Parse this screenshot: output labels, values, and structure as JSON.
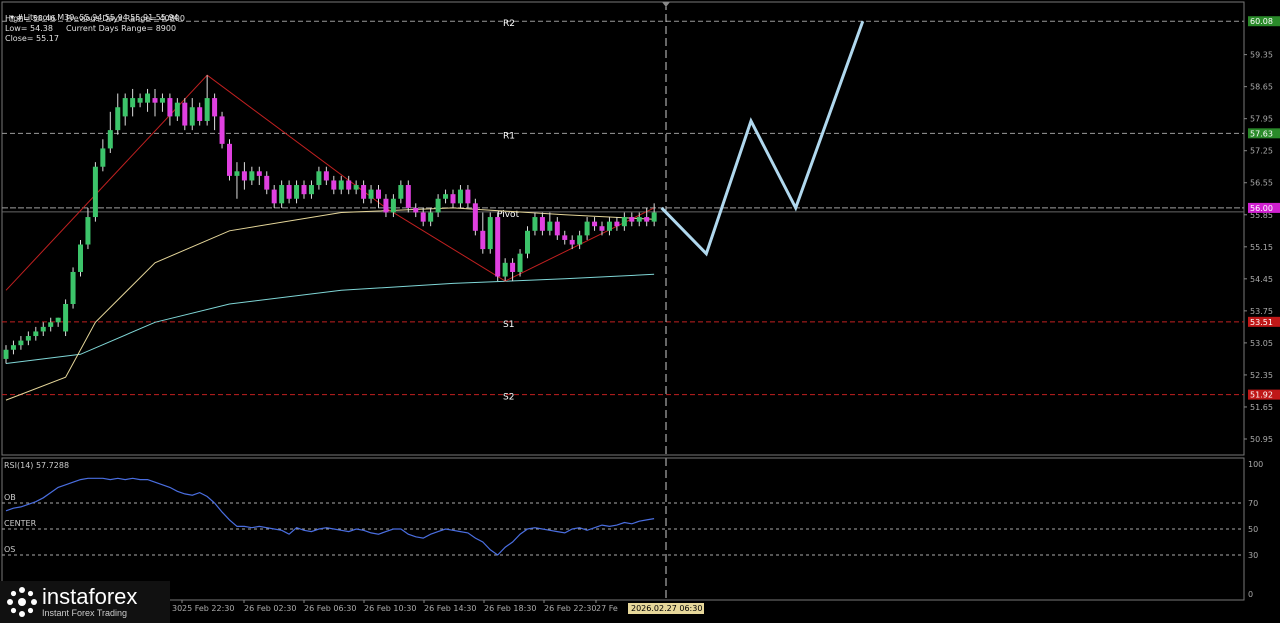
{
  "header": {
    "symbol_line": "#Litecoin,M30  55.94 55.94 55.91 55.94",
    "high": "High= 58.46",
    "low": "Low= 54.38",
    "close": "Close= 55.17",
    "prev_range": "Previous Days Range= 40800",
    "curr_range": "Current Days Range= 8900"
  },
  "colors": {
    "bull": "#3cc46a",
    "bear": "#e040e0",
    "projection": "#b0d8ee",
    "ma_fast": "#e6d79a",
    "ma_slow": "#7fd6d6",
    "zigzag": "#c02020",
    "rsi": "#4a6ee0",
    "pivot_line": "#b0b0b0",
    "support_line": "#c02020"
  },
  "chart_data": [
    {
      "type": "candlestick",
      "title": "#Litecoin,M30",
      "ylim": [
        50.6,
        60.5
      ],
      "y_ticks": [
        "60.08",
        "59.35",
        "58.65",
        "57.95",
        "57.63",
        "57.25",
        "56.55",
        "56.00",
        "55.85",
        "55.15",
        "54.45",
        "53.75",
        "53.51",
        "53.05",
        "52.35",
        "51.92",
        "51.65",
        "50.95"
      ],
      "x_ticks": [
        "25 Feb 22:30",
        "26 Feb 02:30",
        "26 Feb 06:30",
        "26 Feb 10:30",
        "26 Feb 14:30",
        "26 Feb 18:30",
        "26 Feb 22:30",
        "27 Fe",
        "2026.02.27 06:30"
      ],
      "first_x_tick_fragment": "30",
      "levels": [
        {
          "label": "R2",
          "value": 60.08,
          "badge": "60.08",
          "style": "resistance"
        },
        {
          "label": "R1",
          "value": 57.63,
          "badge": "57.63",
          "style": "resistance"
        },
        {
          "label": "Pivot",
          "value": 56.0,
          "badge": "56.00",
          "style": "pivot"
        },
        {
          "label": "S1",
          "value": 53.51,
          "badge": "53.51",
          "style": "support"
        },
        {
          "label": "S2",
          "value": 51.92,
          "badge": "51.92",
          "style": "support"
        }
      ],
      "candles": [
        [
          52.7,
          52.9,
          52.6,
          53.0
        ],
        [
          52.9,
          53.0,
          52.8,
          53.1
        ],
        [
          53.0,
          53.1,
          52.9,
          53.2
        ],
        [
          53.1,
          53.2,
          53.0,
          53.3
        ],
        [
          53.2,
          53.3,
          53.1,
          53.4
        ],
        [
          53.3,
          53.4,
          53.2,
          53.5
        ],
        [
          53.4,
          53.5,
          53.3,
          53.6
        ],
        [
          53.5,
          53.6,
          53.4,
          53.6
        ],
        [
          53.3,
          53.9,
          53.2,
          54.0
        ],
        [
          53.9,
          54.6,
          53.8,
          54.7
        ],
        [
          54.6,
          55.2,
          54.5,
          55.3
        ],
        [
          55.2,
          55.8,
          55.1,
          56.0
        ],
        [
          55.8,
          56.9,
          55.7,
          57.0
        ],
        [
          56.9,
          57.3,
          56.8,
          57.5
        ],
        [
          57.3,
          57.7,
          57.2,
          58.1
        ],
        [
          57.7,
          58.2,
          57.6,
          58.5
        ],
        [
          58.0,
          58.4,
          57.8,
          58.5
        ],
        [
          58.2,
          58.4,
          58.0,
          58.6
        ],
        [
          58.3,
          58.4,
          58.2,
          58.5
        ],
        [
          58.3,
          58.5,
          58.1,
          58.6
        ],
        [
          58.4,
          58.3,
          58.0,
          58.6
        ],
        [
          58.3,
          58.4,
          58.1,
          58.5
        ],
        [
          58.4,
          58.0,
          57.8,
          58.5
        ],
        [
          58.0,
          58.3,
          57.9,
          58.4
        ],
        [
          58.3,
          57.8,
          57.7,
          58.4
        ],
        [
          57.8,
          58.2,
          57.7,
          58.4
        ],
        [
          58.2,
          57.9,
          57.8,
          58.3
        ],
        [
          57.9,
          58.4,
          57.8,
          58.9
        ],
        [
          58.4,
          58.0,
          57.7,
          58.5
        ],
        [
          58.0,
          57.4,
          57.3,
          58.1
        ],
        [
          57.4,
          56.7,
          56.6,
          57.5
        ],
        [
          56.7,
          56.8,
          56.2,
          57.0
        ],
        [
          56.8,
          56.6,
          56.4,
          57.0
        ],
        [
          56.6,
          56.8,
          56.5,
          56.9
        ],
        [
          56.8,
          56.7,
          56.5,
          56.9
        ],
        [
          56.7,
          56.4,
          56.3,
          56.8
        ],
        [
          56.4,
          56.1,
          56.0,
          56.5
        ],
        [
          56.1,
          56.5,
          56.0,
          56.6
        ],
        [
          56.5,
          56.2,
          56.1,
          56.6
        ],
        [
          56.2,
          56.5,
          56.1,
          56.6
        ],
        [
          56.5,
          56.3,
          56.2,
          56.6
        ],
        [
          56.3,
          56.5,
          56.2,
          56.6
        ],
        [
          56.5,
          56.8,
          56.4,
          56.9
        ],
        [
          56.8,
          56.6,
          56.5,
          56.9
        ],
        [
          56.6,
          56.4,
          56.3,
          56.7
        ],
        [
          56.4,
          56.6,
          56.3,
          56.7
        ],
        [
          56.6,
          56.4,
          56.3,
          56.7
        ],
        [
          56.4,
          56.5,
          56.3,
          56.6
        ],
        [
          56.5,
          56.2,
          56.1,
          56.6
        ],
        [
          56.2,
          56.4,
          56.1,
          56.5
        ],
        [
          56.4,
          56.2,
          56.0,
          56.5
        ],
        [
          56.2,
          55.9,
          55.8,
          56.3
        ],
        [
          55.9,
          56.2,
          55.8,
          56.3
        ],
        [
          56.2,
          56.5,
          56.1,
          56.6
        ],
        [
          56.5,
          56.0,
          55.9,
          56.6
        ],
        [
          56.0,
          55.9,
          55.8,
          56.1
        ],
        [
          55.9,
          55.7,
          55.6,
          56.0
        ],
        [
          55.7,
          55.9,
          55.6,
          56.0
        ],
        [
          55.9,
          56.2,
          55.8,
          56.3
        ],
        [
          56.2,
          56.3,
          56.1,
          56.4
        ],
        [
          56.3,
          56.1,
          56.0,
          56.4
        ],
        [
          56.1,
          56.4,
          56.0,
          56.5
        ],
        [
          56.4,
          56.1,
          56.0,
          56.5
        ],
        [
          56.1,
          55.5,
          55.4,
          56.2
        ],
        [
          55.5,
          55.1,
          55.0,
          55.9
        ],
        [
          55.1,
          55.8,
          55.0,
          55.9
        ],
        [
          55.8,
          54.5,
          54.4,
          55.9
        ],
        [
          54.5,
          54.8,
          54.4,
          54.9
        ],
        [
          54.8,
          54.6,
          54.4,
          54.9
        ],
        [
          54.6,
          55.0,
          54.5,
          55.1
        ],
        [
          55.0,
          55.5,
          54.9,
          55.6
        ],
        [
          55.5,
          55.8,
          55.4,
          55.9
        ],
        [
          55.8,
          55.5,
          55.4,
          55.9
        ],
        [
          55.5,
          55.7,
          55.4,
          55.9
        ],
        [
          55.7,
          55.4,
          55.3,
          55.8
        ],
        [
          55.4,
          55.3,
          55.2,
          55.5
        ],
        [
          55.3,
          55.2,
          55.1,
          55.4
        ],
        [
          55.2,
          55.4,
          55.1,
          55.5
        ],
        [
          55.4,
          55.7,
          55.3,
          55.8
        ],
        [
          55.7,
          55.6,
          55.5,
          55.8
        ],
        [
          55.6,
          55.5,
          55.4,
          55.7
        ],
        [
          55.5,
          55.7,
          55.4,
          55.8
        ],
        [
          55.7,
          55.6,
          55.5,
          55.8
        ],
        [
          55.6,
          55.8,
          55.5,
          55.9
        ],
        [
          55.8,
          55.7,
          55.6,
          55.9
        ],
        [
          55.7,
          55.8,
          55.6,
          55.9
        ],
        [
          55.8,
          55.7,
          55.6,
          56.0
        ],
        [
          55.7,
          55.9,
          55.6,
          56.1
        ]
      ],
      "ma_fast": [
        [
          0,
          51.8
        ],
        [
          8,
          52.3
        ],
        [
          12,
          53.5
        ],
        [
          20,
          54.8
        ],
        [
          30,
          55.5
        ],
        [
          45,
          55.9
        ],
        [
          60,
          56.0
        ],
        [
          75,
          55.85
        ],
        [
          87,
          55.75
        ]
      ],
      "ma_slow": [
        [
          0,
          52.6
        ],
        [
          10,
          52.8
        ],
        [
          20,
          53.5
        ],
        [
          30,
          53.9
        ],
        [
          45,
          54.2
        ],
        [
          60,
          54.35
        ],
        [
          75,
          54.45
        ],
        [
          87,
          54.55
        ]
      ],
      "zigzag": [
        [
          0,
          54.2
        ],
        [
          27,
          58.9
        ],
        [
          51,
          56.0
        ],
        [
          67,
          54.4
        ],
        [
          87,
          56.0
        ]
      ],
      "projection": [
        [
          88,
          56.0
        ],
        [
          94,
          55.0
        ],
        [
          100,
          57.9
        ],
        [
          106,
          56.0
        ],
        [
          115,
          60.08
        ]
      ]
    },
    {
      "type": "line",
      "title": "RSI(14) 57.7288",
      "ylim": [
        0,
        100
      ],
      "y_ticks": [
        "100",
        "70",
        "50",
        "30",
        "0"
      ],
      "levels": [
        {
          "label": "OB",
          "value": 70
        },
        {
          "label": "CENTER",
          "value": 50
        },
        {
          "label": "OS",
          "value": 30
        }
      ],
      "values": [
        64,
        66,
        67,
        69,
        71,
        74,
        78,
        82,
        84,
        86,
        88,
        89,
        89,
        89,
        88,
        89,
        88,
        89,
        88,
        88,
        86,
        84,
        82,
        79,
        77,
        76,
        78,
        75,
        70,
        63,
        57,
        52,
        52,
        51,
        52,
        51,
        50,
        49,
        46,
        51,
        49,
        48,
        50,
        51,
        50,
        49,
        48,
        50,
        49,
        47,
        46,
        48,
        50,
        50,
        46,
        44,
        43,
        46,
        48,
        50,
        49,
        48,
        47,
        43,
        40,
        34,
        30,
        36,
        40,
        46,
        50,
        51,
        50,
        49,
        48,
        47,
        50,
        51,
        49,
        51,
        53,
        52,
        53,
        55,
        54,
        56,
        57,
        58
      ]
    }
  ],
  "logo": {
    "brand": "instaforex",
    "tagline": "Instant Forex Trading"
  }
}
